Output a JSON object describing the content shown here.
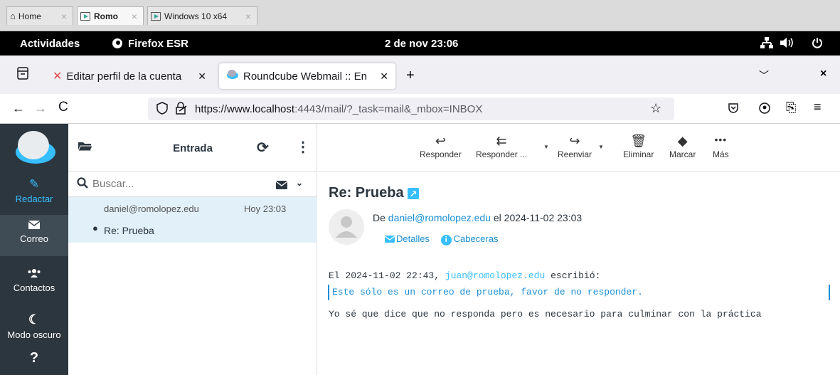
{
  "vm_tabs": [
    {
      "label": "Home"
    },
    {
      "label": "Romo"
    },
    {
      "label": "Windows 10 x64"
    }
  ],
  "gnome": {
    "activities": "Actividades",
    "app": "Firefox ESR",
    "clock": "2 de nov  23:06"
  },
  "browser": {
    "tabs": [
      {
        "label": "Editar perfil de la cuenta"
      },
      {
        "label": "Roundcube Webmail :: En"
      }
    ],
    "url_host": "https://www.localhost",
    "url_path": ":4443/mail/?_task=mail&_mbox=INBOX"
  },
  "sidebar": {
    "items": [
      {
        "label": "Redactar",
        "icon": "compose-icon"
      },
      {
        "label": "Correo",
        "icon": "mail-icon"
      },
      {
        "label": "Contactos",
        "icon": "contacts-icon"
      },
      {
        "label": "Modo oscuro",
        "icon": "moon-icon"
      },
      {
        "label": "",
        "icon": "help-icon"
      }
    ]
  },
  "mail_list": {
    "folder_title": "Entrada",
    "search_placeholder": "Buscar...",
    "messages": [
      {
        "from": "daniel@romolopez.edu",
        "date": "Hoy 23:03",
        "subject": "Re: Prueba"
      }
    ]
  },
  "toolbar": {
    "reply": "Responder",
    "reply_all": "Responder ...",
    "forward": "Reenviar",
    "delete": "Eliminar",
    "mark": "Marcar",
    "more": "Más"
  },
  "message": {
    "subject": "Re: Prueba",
    "from_prefix": "De",
    "from_address": "daniel@romolopez.edu",
    "date_text": "el 2024-11-02 23:03",
    "details_label": "Detalles",
    "headers_label": "Cabeceras",
    "quote_intro_prefix": "El 2024-11-02 22:43,",
    "quote_intro_address": "juan@romolopez.edu",
    "quote_intro_suffix": "escribió:",
    "quoted_text": "Este sólo es un correo de prueba, favor de no responder.",
    "body_text": "Yo sé que dice que no responda pero es necesario para culminar con la práctica"
  }
}
